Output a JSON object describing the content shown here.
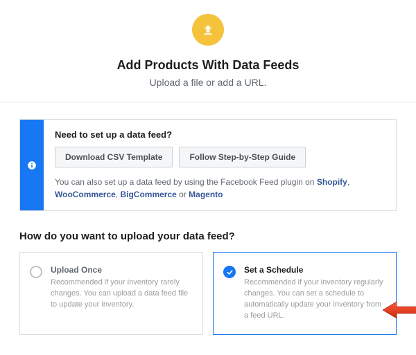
{
  "hero": {
    "title": "Add Products With Data Feeds",
    "subtitle": "Upload a file or add a URL."
  },
  "info": {
    "title": "Need to set up a data feed?",
    "buttons": {
      "download": "Download CSV Template",
      "guide": "Follow Step-by-Step Guide"
    },
    "text_prefix": "You can also set up a data feed by using the Facebook Feed plugin on ",
    "links": {
      "shopify": "Shopify",
      "woo": "WooCommerce",
      "bigcommerce": "BigCommerce",
      "magento": "Magento"
    },
    "sep_comma": ", ",
    "sep_or": " or "
  },
  "section": {
    "heading": "How do you want to upload your data feed?"
  },
  "options": {
    "once": {
      "title": "Upload Once",
      "desc": "Recommended if your inventory rarely changes. You can upload a data feed file to update your inventory."
    },
    "schedule": {
      "title": "Set a Schedule",
      "desc": "Recommended if your inventory regularly changes. You can set a schedule to automatically update your inventory from a feed URL."
    }
  }
}
